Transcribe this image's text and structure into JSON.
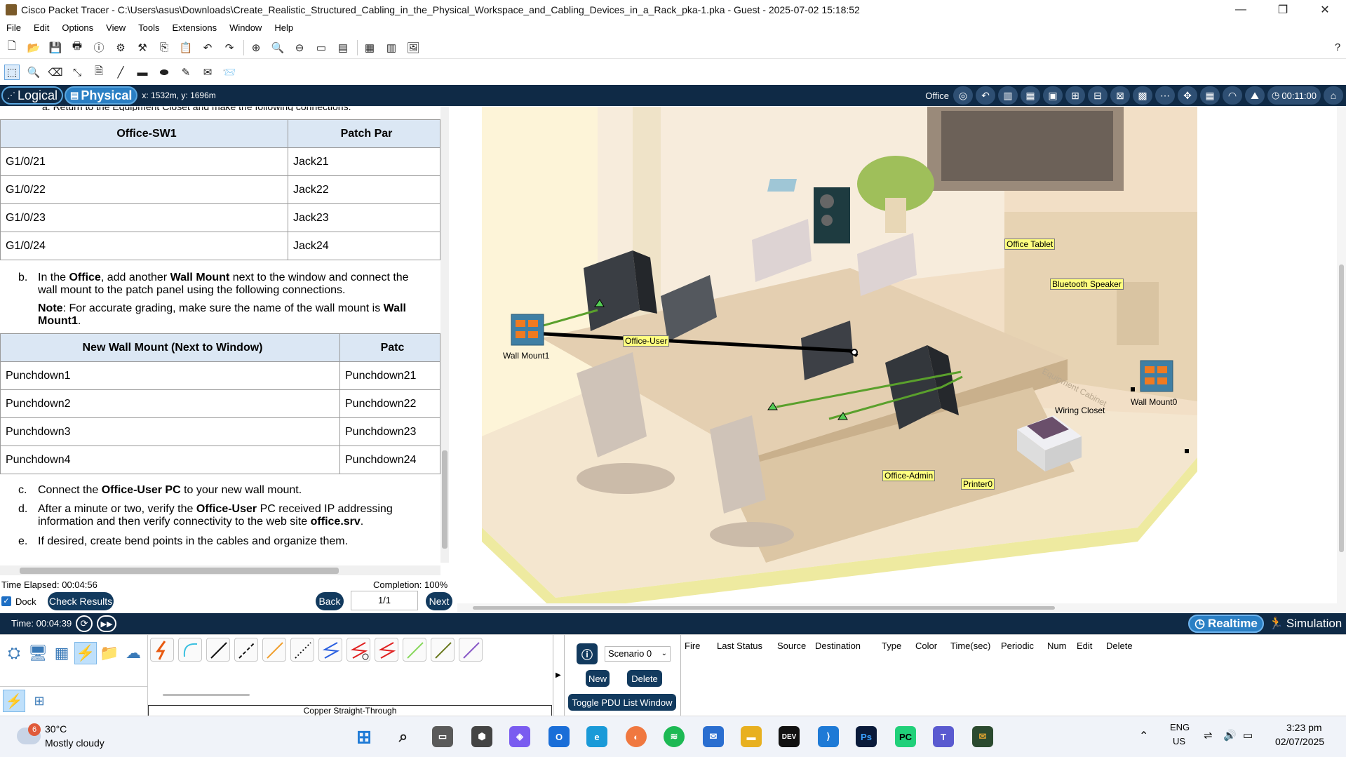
{
  "window": {
    "title": "Cisco Packet Tracer - C:\\Users\\asus\\Downloads\\Create_Realistic_Structured_Cabling_in_the_Physical_Workspace_and_Cabling_Devices_in_a_Rack_pka-1.pka - Guest - 2025-07-02 15:18:52",
    "minimize": "—",
    "maximize": "❐",
    "close": "✕"
  },
  "menu": [
    "File",
    "Edit",
    "Options",
    "View",
    "Tools",
    "Extensions",
    "Window",
    "Help"
  ],
  "modebar": {
    "logical": "Logical",
    "physical": "Physical",
    "coords": "x: 1532m, y: 1696m",
    "location": "Office",
    "clock": "00:11:00"
  },
  "instructions": {
    "clipped_line": "a.   Return to the Equipment Closet and make the following connections.",
    "table1": {
      "headers": [
        "Office-SW1",
        "Patch Par"
      ],
      "rows": [
        [
          "G1/0/21",
          "Jack21"
        ],
        [
          "G1/0/22",
          "Jack22"
        ],
        [
          "G1/0/23",
          "Jack23"
        ],
        [
          "G1/0/24",
          "Jack24"
        ]
      ]
    },
    "step_b": {
      "letter": "b.",
      "t1": "In the ",
      "b1": "Office",
      "t2": ", add another ",
      "b2": "Wall Mount",
      "t3": " next to the window and connect the wall mount to the patch panel using the following connections.",
      "note_label": "Note",
      "note_text": ": For accurate grading, make sure the name of the wall mount is ",
      "note_bold": "Wall Mount1",
      "note_end": "."
    },
    "table2": {
      "headers": [
        "New Wall Mount (Next to Window)",
        "Patc"
      ],
      "rows": [
        [
          "Punchdown1",
          "Punchdown21"
        ],
        [
          "Punchdown2",
          "Punchdown22"
        ],
        [
          "Punchdown3",
          "Punchdown23"
        ],
        [
          "Punchdown4",
          "Punchdown24"
        ]
      ]
    },
    "step_c": {
      "letter": "c.",
      "t1": "Connect the ",
      "b1": "Office-User PC",
      "t2": " to your new wall mount."
    },
    "step_d": {
      "letter": "d.",
      "t1": "After a minute or two, verify the ",
      "b1": "Office-User",
      "t2": " PC received IP addressing information and then verify connectivity to the web site ",
      "b2": "office.srv",
      "t3": "."
    },
    "step_e": {
      "letter": "e.",
      "t1": "If desired, create bend points in the cables and organize them."
    }
  },
  "activity": {
    "time_elapsed": "Time Elapsed: 00:04:56",
    "completion": "Completion: 100%",
    "dock": "Dock",
    "check_results": "Check Results",
    "back": "Back",
    "page": "1/1",
    "next": "Next"
  },
  "workspace": {
    "devices": {
      "wall_mount1": "Wall Mount1",
      "office_user": "Office-User",
      "office_tablet": "Office Tablet",
      "bluetooth_speaker": "Bluetooth Speaker",
      "wall_mount0": "Wall Mount0",
      "office_admin": "Office-Admin",
      "printer0": "Printer0",
      "wiring_closet": "Wiring Closet",
      "equipment_cabinet": "Equipment Cabinet"
    }
  },
  "bottombar": {
    "time": "Time: 00:04:39",
    "realtime": "Realtime",
    "simulation": "Simulation"
  },
  "devicepanel": {
    "cable_name": "Copper Straight-Through",
    "scenario": "Scenario 0",
    "new": "New",
    "delete": "Delete",
    "toggle_pdu": "Toggle PDU List Window",
    "pdu_columns": [
      "Fire",
      "Last Status",
      "Source",
      "Destination",
      "Type",
      "Color",
      "Time(sec)",
      "Periodic",
      "Num",
      "Edit",
      "Delete"
    ]
  },
  "taskbar": {
    "temp": "30°C",
    "weather": "Mostly cloudy",
    "weather_badge": "6",
    "lang1": "ENG",
    "lang2": "US",
    "time": "3:23 pm",
    "date": "02/07/2025"
  },
  "colors": {
    "modebar_bg": "#0f2a46",
    "header_bg": "#dbe7f4",
    "label_bg": "#ffff80",
    "cable_green": "#5aa02c",
    "accent": "#2a7fc4"
  }
}
